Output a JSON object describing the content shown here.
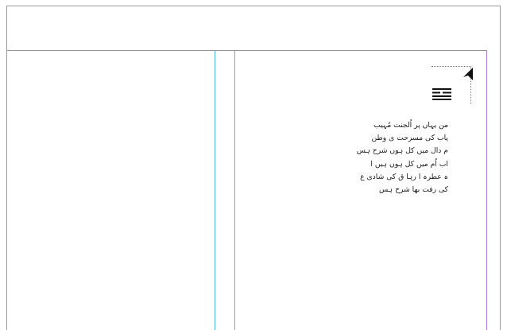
{
  "document": {
    "text_lines": [
      "من یہاں پر اُلجنت مُہیب",
      "پاب کی مسرحت ی وطن",
      "م دال میں کل ہوں شرح ہس",
      "اب اُم میں کل ہوں ہیں ا",
      "ہ عطرہ ا رہا ق کی شادی ع",
      "کی رفت بھا شرح ہس"
    ]
  },
  "icons": {
    "cursor": "arrow-cursor-icon",
    "alignment": "justify-all-lines-icon"
  },
  "colors": {
    "margin_guide": "#b07ad8",
    "column_guide": "#4fb6e6",
    "pasteboard_border": "#9a9a9a"
  }
}
